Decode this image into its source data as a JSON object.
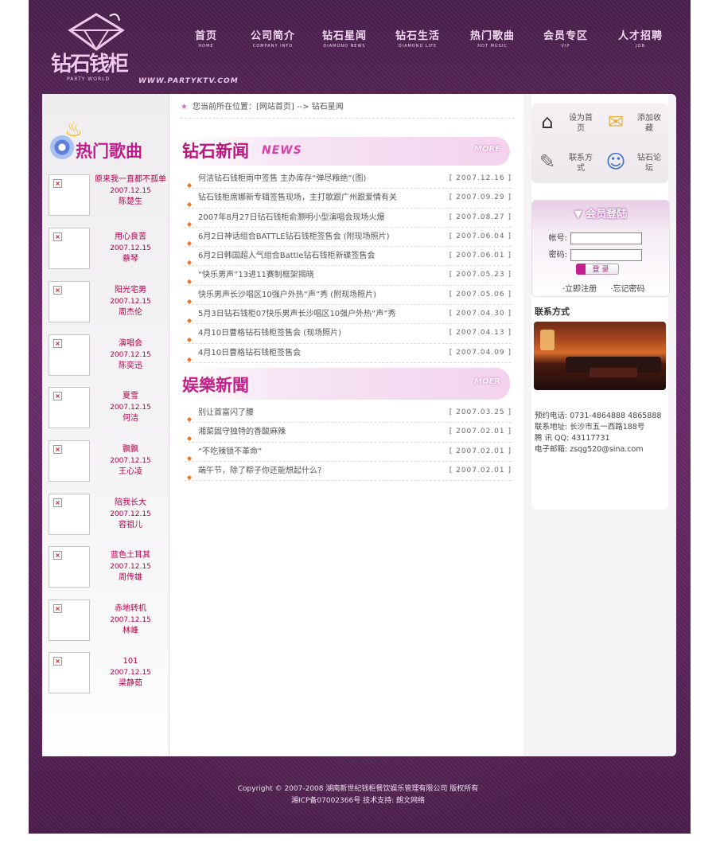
{
  "header": {
    "brand": "钻石钱柜",
    "brand_sub": "PARTY WORLD",
    "url": "WWW.PARTYKTV.COM",
    "nav": [
      {
        "cn": "首页",
        "en": "HOME"
      },
      {
        "cn": "公司简介",
        "en": "COMPANY INFO"
      },
      {
        "cn": "钻石星闻",
        "en": "DIAMOND NEWS"
      },
      {
        "cn": "钻石生活",
        "en": "DIAMOND LIFE"
      },
      {
        "cn": "热门歌曲",
        "en": "HOT MUSIC"
      },
      {
        "cn": "会员专区",
        "en": "VIP"
      },
      {
        "cn": "人才招聘",
        "en": "JOB"
      }
    ]
  },
  "left": {
    "title": "热门歌曲",
    "songs": [
      {
        "name": "原来我一直都不孤单",
        "date": "2007.12.15",
        "artist": "陈楚生"
      },
      {
        "name": "用心良苦",
        "date": "2007.12.15",
        "artist": "蔡琴"
      },
      {
        "name": "阳光宅男",
        "date": "2007.12.15",
        "artist": "周杰伦"
      },
      {
        "name": "演唱会",
        "date": "2007.12.15",
        "artist": "陈奕迅"
      },
      {
        "name": "夏雪",
        "date": "2007.12.15",
        "artist": "何洁"
      },
      {
        "name": "飘飘",
        "date": "2007.12.15",
        "artist": "王心凌"
      },
      {
        "name": "陪我长大",
        "date": "2007.12.15",
        "artist": "容祖儿"
      },
      {
        "name": "蓝色土耳其",
        "date": "2007.12.15",
        "artist": "周传雄"
      },
      {
        "name": "赤地转机",
        "date": "2007.12.15",
        "artist": "林峰"
      },
      {
        "name": "101",
        "date": "2007.12.15",
        "artist": "梁静茹"
      }
    ]
  },
  "center": {
    "breadcrumb": "您当前所在位置：[网站首页] --> 钻石星闻",
    "news_banner": {
      "title": "钻石新闻",
      "en": "NEWS",
      "more": "MORE"
    },
    "news": [
      {
        "title": "何洁钻石钱柜雨中签售 主办库存“弹尽粮绝”(图)",
        "date": "[ 2007.12.16 ]"
      },
      {
        "title": "钻石钱柜席娜新专辑签售现场，主打歌跟广州跟爱情有关",
        "date": "[ 2007.09.29 ]"
      },
      {
        "title": "2007年8月27日钻石钱柜俞灏明小型演唱会现场火爆",
        "date": "[ 2007.08.27 ]"
      },
      {
        "title": "6月2日神话组合BATTLE钻石钱柜签售会 (附现场照片)",
        "date": "[ 2007.06.04 ]"
      },
      {
        "title": "6月2日韩国超人气组合Battle钻石钱柜新碟签售会",
        "date": "[ 2007.06.01 ]"
      },
      {
        "title": "“快乐男声”13进11赛制框架揭晓",
        "date": "[ 2007.05.23 ]"
      },
      {
        "title": "快乐男声长沙唱区10强户外热“声”秀 (附现场照片)",
        "date": "[ 2007.05.06 ]"
      },
      {
        "title": "5月3日钻石钱柜07快乐男声长沙唱区10强户外热“声”秀",
        "date": "[ 2007.04.30 ]"
      },
      {
        "title": "4月10日曹格钻石钱柜签售会 (现场照片)",
        "date": "[ 2007.04.13 ]"
      },
      {
        "title": "4月10日曹格钻石钱柜签售会",
        "date": "[ 2007.04.09 ]"
      }
    ],
    "ent_banner": {
      "title": "娱樂新聞",
      "more": "MOER"
    },
    "ent_news": [
      {
        "title": "别让首富闪了腰",
        "date": "[ 2007.03.25 ]"
      },
      {
        "title": "湘菜固守独特的香酸麻辣",
        "date": "[ 2007.02.01 ]"
      },
      {
        "title": "“不吃辣锁不革命”",
        "date": "[ 2007.02.01 ]"
      },
      {
        "title": "端午节，除了粽子你还能想起什么?",
        "date": "[ 2007.02.01 ]"
      }
    ]
  },
  "right": {
    "quick": [
      {
        "label": "设为首页",
        "icon": "home-icon"
      },
      {
        "label": "添加收藏",
        "icon": "folder-star-icon"
      },
      {
        "label": "联系方式",
        "icon": "notepad-icon"
      },
      {
        "label": "钻石论坛",
        "icon": "finder-icon"
      }
    ],
    "login": {
      "title": "会员登陆",
      "user_label": "帐号:",
      "pass_label": "密码:",
      "button": "登 录",
      "register": "·立即注册",
      "forgot": "·忘记密码"
    },
    "contact_title": "联系方式",
    "contact": {
      "phone": "预约电话: 0731-4864888 4865888",
      "address": "联系地址: 长沙市五一西路188号",
      "qq": "腾 讯 QQ: 43117731",
      "email": "电子邮箱: zsqg520@sina.com"
    }
  },
  "footer": {
    "line1": "Copyright © 2007-2008 湖南新世纪钱柜餐饮娱乐管理有限公司 版权所有",
    "line2": "湘ICP备07002366号 技术支持: 朗文网络"
  }
}
